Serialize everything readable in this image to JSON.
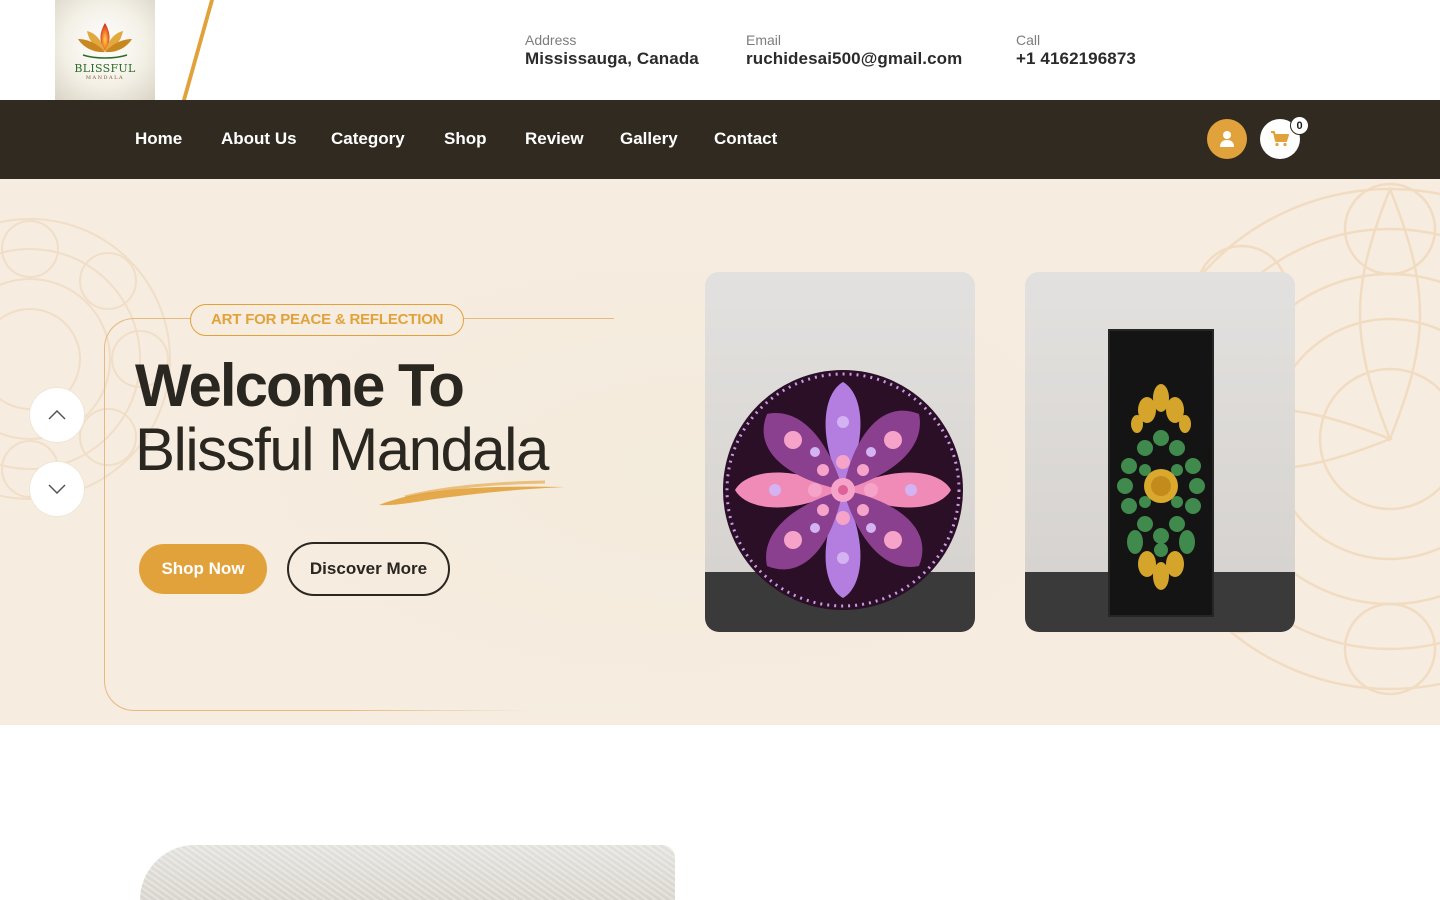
{
  "brand": {
    "name": "BLISSFUL",
    "sub": "MANDALA"
  },
  "contact": {
    "address": {
      "label": "Address",
      "value": "Mississauga, Canada"
    },
    "email": {
      "label": "Email",
      "value": "ruchidesai500@gmail.com"
    },
    "call": {
      "label": "Call",
      "value": "+1 4162196873"
    }
  },
  "nav": {
    "items": [
      {
        "label": "Home"
      },
      {
        "label": "About Us"
      },
      {
        "label": "Category"
      },
      {
        "label": "Shop"
      },
      {
        "label": "Review"
      },
      {
        "label": "Gallery"
      },
      {
        "label": "Contact"
      }
    ],
    "user_icon": "user-icon",
    "cart_icon": "shopping-cart-icon",
    "cart_count": "0"
  },
  "hero": {
    "tagline": "ART FOR PEACE & REFLECTION",
    "title_line1": "Welcome To",
    "title_line2": "Blissful Mandala",
    "shop_label": "Shop Now",
    "discover_label": "Discover More",
    "prev_icon": "chevron-up-icon",
    "next_icon": "chevron-down-icon"
  },
  "colors": {
    "accent": "#e2a23b",
    "nav_bg": "#302a20",
    "hero_bg": "#f6ece0",
    "text_dark": "#2a2620"
  }
}
